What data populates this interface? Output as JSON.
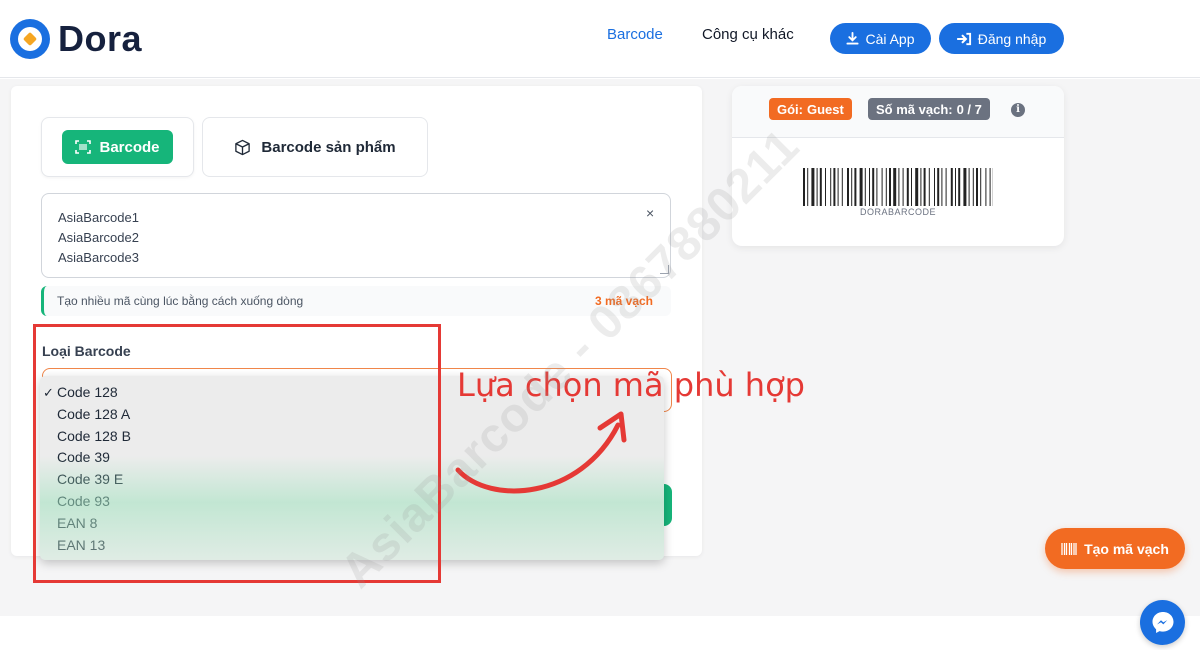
{
  "header": {
    "brand": "Dora",
    "nav": {
      "barcode": "Barcode",
      "tools": "Công cụ khác"
    },
    "install_label": "Cài App",
    "login_label": "Đăng nhập"
  },
  "tabs": {
    "barcode": "Barcode",
    "product_barcode": "Barcode sản phẩm"
  },
  "input": {
    "lines": [
      "AsiaBarcode1",
      "AsiaBarcode2",
      "AsiaBarcode3"
    ],
    "clear_symbol": "×"
  },
  "hint": {
    "text": "Tạo nhiều mã cùng lúc bằng cách xuống dòng",
    "count": "3 mã vạch"
  },
  "barcode_type": {
    "label": "Loại Barcode",
    "selected": "Code 128",
    "options": [
      "Code 128",
      "Code 128 A",
      "Code 128 B",
      "Code 39",
      "Code 39 E",
      "Code 93",
      "EAN 8",
      "EAN 13"
    ]
  },
  "annotation": "Lựa chọn mã phù hợp",
  "watermark": "AsiaBarcode - 0867880211",
  "preview": {
    "plan_label": "Gói:",
    "plan_value": "Guest",
    "count_label": "Số mã vạch:",
    "count_value": "0 / 7",
    "info_symbol": "i",
    "barcode_caption": "DORABARCODE"
  },
  "fab_label": "Tạo mã vạch",
  "colors": {
    "primary": "#1a6fe0",
    "success": "#16b57a",
    "accent": "#f26b22",
    "highlight": "#e53935"
  }
}
